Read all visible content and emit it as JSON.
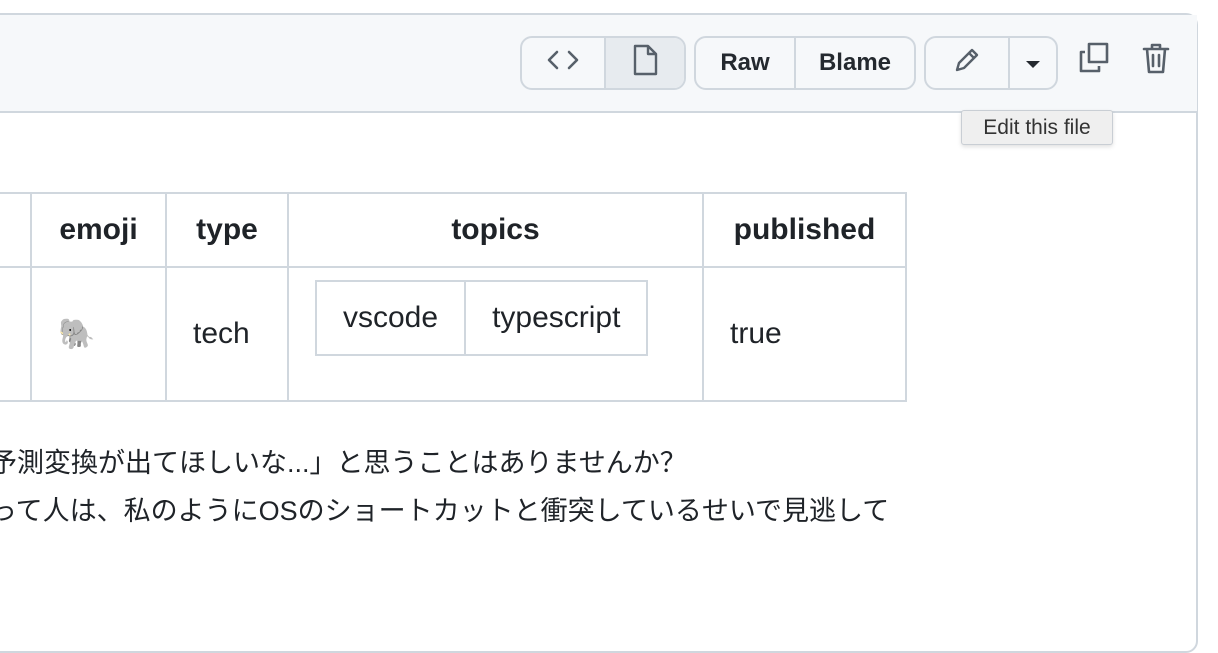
{
  "toolbar": {
    "code_label": "<>",
    "raw_label": "Raw",
    "blame_label": "Blame",
    "tooltip": "Edit this file"
  },
  "table": {
    "headers": [
      "emoji",
      "type",
      "topics",
      "published"
    ],
    "row": {
      "emoji": "🐘",
      "type": "tech",
      "topics": [
        "vscode",
        "typescript"
      ],
      "published": "true"
    }
  },
  "body": {
    "line1": "予測変換が出てほしいな...」と思うことはありませんか？",
    "line2": "って人は、私のようにOSのショートカットと衝突しているせいで見逃して"
  },
  "icons": {
    "code": "code-icon",
    "file": "file-icon",
    "pencil": "pencil-icon",
    "caret": "caret-down-icon",
    "copy": "copy-icon",
    "trash": "trash-icon"
  }
}
